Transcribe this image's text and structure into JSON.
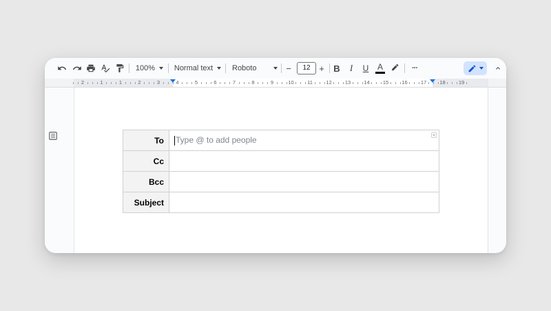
{
  "toolbar": {
    "zoom": "100%",
    "style": "Normal text",
    "font": "Roboto",
    "font_size": "12",
    "decrease_symbol": "−",
    "increase_symbol": "+",
    "bold": "B",
    "italic": "I",
    "underline": "U",
    "text_color": "A",
    "more": "···"
  },
  "ruler": {
    "labels": [
      "2",
      "1",
      "1",
      "2",
      "3",
      "4",
      "5",
      "6",
      "7",
      "8",
      "9",
      "10",
      "11",
      "12",
      "13",
      "14",
      "15",
      "16",
      "17",
      "18",
      "19"
    ]
  },
  "email": {
    "to_label": "To",
    "to_placeholder": "Type @ to add people",
    "cc_label": "Cc",
    "bcc_label": "Bcc",
    "subject_label": "Subject"
  },
  "colors": {
    "accent": "#1a73e8",
    "edit_mode_bg": "#d3e3fd",
    "label_bg": "#f3f3f3"
  }
}
